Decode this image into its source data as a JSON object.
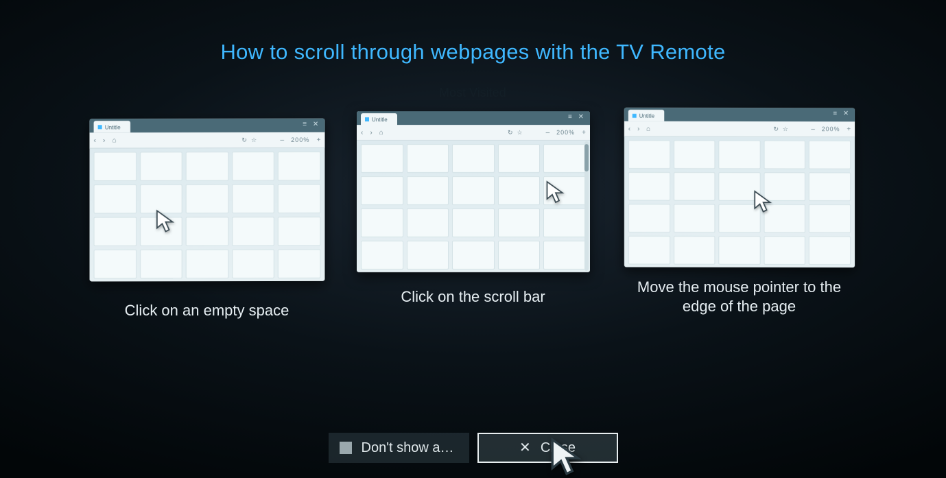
{
  "title": "How to scroll through webpages with the TV Remote",
  "browser": {
    "tab_label": "Untitle",
    "window_controls": "≡ ✕",
    "nav_back": "‹",
    "nav_fwd": "›",
    "home": "⌂",
    "reload": "↻",
    "star": "☆",
    "minus": "–",
    "zoom": "200%",
    "plus": "+"
  },
  "cards": [
    {
      "caption": "Click on an empty space"
    },
    {
      "caption": "Click on the scroll bar"
    },
    {
      "caption": "Move the mouse pointer to the edge of the page"
    }
  ],
  "footer": {
    "dont_show": "Don't show a…",
    "close": "Close"
  }
}
